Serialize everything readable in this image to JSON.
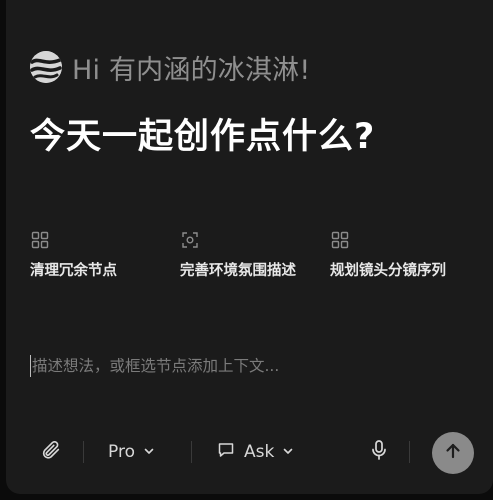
{
  "greeting": {
    "text": "Hi 有内涵的冰淇淋!"
  },
  "headline": "今天一起创作点什么?",
  "suggestions": [
    {
      "label": "清理冗余节点",
      "icon": "grid-icon"
    },
    {
      "label": "完善环境氛围描述",
      "icon": "focus-frame-icon"
    },
    {
      "label": "规划镜头分镜序列",
      "icon": "grid-icon"
    }
  ],
  "input": {
    "placeholder": "描述想法，或框选节点添加上下文..."
  },
  "toolbar": {
    "attach_icon": "paperclip-icon",
    "model_label": "Pro",
    "mode_label": "Ask",
    "mode_icon": "chat-bubble-icon",
    "mic_icon": "microphone-icon",
    "send_icon": "arrow-up-icon"
  },
  "colors": {
    "panel_bg": "#1b1b1b",
    "outer_bg": "#0b0b0b",
    "greeting_text": "#8f8f8f",
    "send_button": "#8a8a8a"
  }
}
